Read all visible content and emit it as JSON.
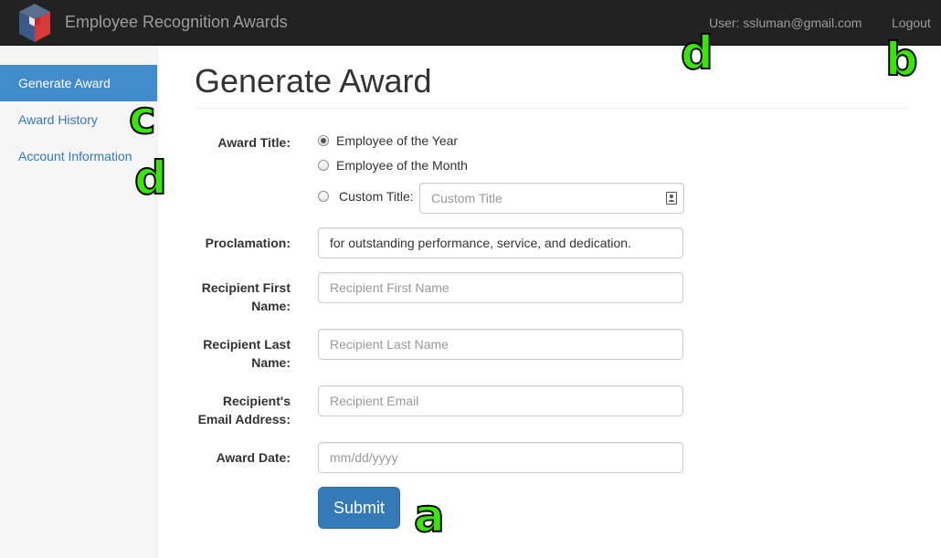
{
  "navbar": {
    "brand": "Employee Recognition Awards",
    "user": "User: ssluman@gmail.com",
    "logout": "Logout"
  },
  "sidebar": {
    "items": [
      {
        "label": "Generate Award",
        "active": true
      },
      {
        "label": "Award History",
        "active": false
      },
      {
        "label": "Account Information",
        "active": false
      }
    ]
  },
  "main": {
    "title": "Generate Award",
    "form": {
      "award_title_label": "Award Title:",
      "radios": [
        {
          "label": "Employee of the Year",
          "checked": true
        },
        {
          "label": "Employee of the Month",
          "checked": false
        },
        {
          "label": "Custom Title:",
          "checked": false
        }
      ],
      "custom_title_placeholder": "Custom Title",
      "proclamation_label": "Proclamation:",
      "proclamation_value": "for outstanding performance, service, and dedication.",
      "first_name_label_1": "Recipient First",
      "first_name_label_2": "Name:",
      "first_name_placeholder": "Recipient First Name",
      "last_name_label_1": "Recipient Last",
      "last_name_label_2": "Name:",
      "last_name_placeholder": "Recipient Last Name",
      "email_label_1": "Recipient's",
      "email_label_2": "Email Address:",
      "email_placeholder": "Recipient Email",
      "date_label": "Award Date:",
      "date_placeholder": "mm/dd/yyyy",
      "submit_label": "Submit"
    }
  },
  "annotations": {
    "a": "a",
    "b": "b",
    "c": "c",
    "d_top": "d",
    "d_side": "d"
  },
  "colors": {
    "navbar_bg": "#222222",
    "sidebar_active": "#428bca",
    "link": "#337ab7",
    "primary_button": "#337ab7",
    "annotation_green": "#39e600"
  },
  "icons": {
    "logo": "cube-logo-icon",
    "contact": "contact-card-icon"
  }
}
